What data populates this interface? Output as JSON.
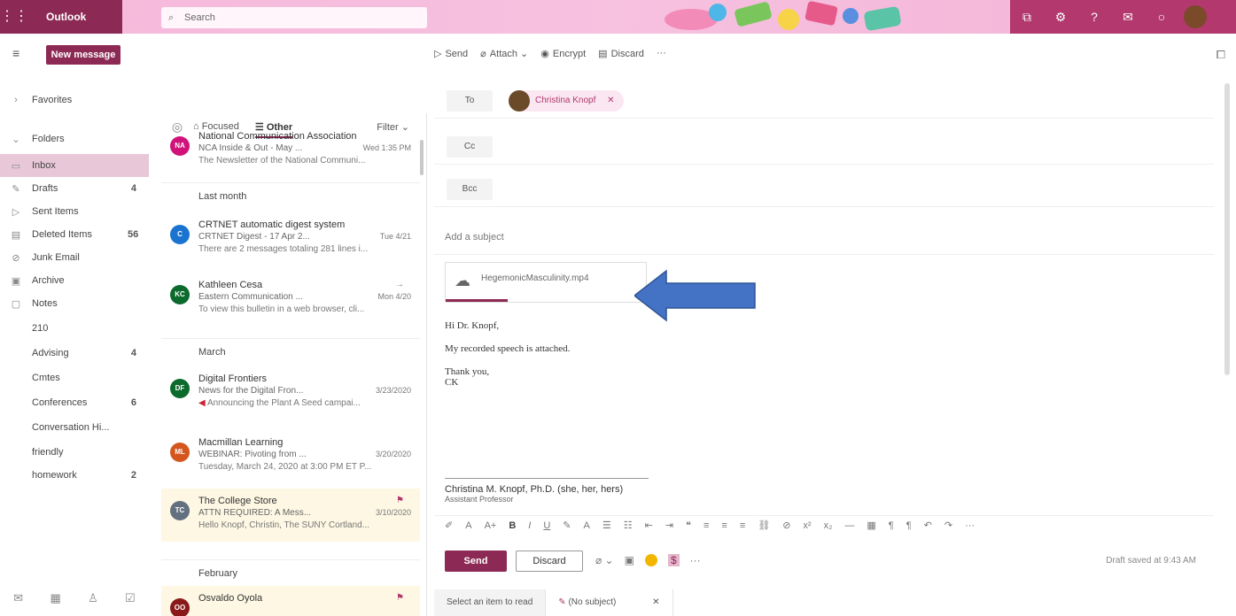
{
  "app": {
    "brand": "Outlook",
    "waffle_icon": "waffle-icon"
  },
  "search": {
    "placeholder": "Search"
  },
  "top_icons": [
    "meet-now-icon",
    "settings-icon",
    "help-icon",
    "feedback-icon",
    "skype-icon"
  ],
  "command": {
    "new_message": "New message"
  },
  "toolbar": {
    "send": "Send",
    "attach": "Attach",
    "encrypt": "Encrypt",
    "discard": "Discard",
    "more": "···"
  },
  "nav": {
    "items": [
      {
        "icon": "chevron-right-icon",
        "label": "Favorites",
        "count": ""
      },
      {
        "icon": "chevron-down-icon",
        "label": "Folders",
        "count": ""
      },
      {
        "icon": "inbox-icon",
        "label": "Inbox",
        "count": ""
      },
      {
        "icon": "pencil-icon",
        "label": "Drafts",
        "count": "4"
      },
      {
        "icon": "send-icon",
        "label": "Sent Items",
        "count": ""
      },
      {
        "icon": "trash-icon",
        "label": "Deleted Items",
        "count": "56"
      },
      {
        "icon": "block-icon",
        "label": "Junk Email",
        "count": ""
      },
      {
        "icon": "archive-icon",
        "label": "Archive",
        "count": ""
      },
      {
        "icon": "notes-icon",
        "label": "Notes",
        "count": ""
      },
      {
        "icon": "",
        "label": "210",
        "count": ""
      },
      {
        "icon": "",
        "label": "Advising",
        "count": "4"
      },
      {
        "icon": "",
        "label": "Cmtes",
        "count": ""
      },
      {
        "icon": "",
        "label": "Conferences",
        "count": "6"
      },
      {
        "icon": "",
        "label": "Conversation Hi...",
        "count": ""
      },
      {
        "icon": "",
        "label": "friendly",
        "count": ""
      },
      {
        "icon": "",
        "label": "homework",
        "count": "2"
      }
    ]
  },
  "list": {
    "tabs": {
      "focused": "Focused",
      "other": "Other",
      "filter": "Filter"
    },
    "groups": {
      "last_month": "Last month",
      "march": "March",
      "february": "February"
    },
    "messages": [
      {
        "initials": "NA",
        "from": "National Communication Association",
        "subject": "NCA Inside & Out - May ...",
        "date": "Wed 1:35 PM",
        "preview": "The Newsletter of the National Communi...",
        "color": "#d0127a"
      },
      {
        "initials": "C",
        "from": "CRTNET automatic digest system",
        "subject": "CRTNET Digest - 17 Apr 2...",
        "date": "Tue 4/21",
        "preview": "There are 2 messages totaling 281 lines i...",
        "color": "#1a73d1"
      },
      {
        "initials": "KC",
        "from": "Kathleen Cesa",
        "subject": "Eastern Communication ...",
        "date": "Mon 4/20",
        "preview": "To view this bulletin in a web browser, cli...",
        "color": "#0b6a2c"
      },
      {
        "initials": "DF",
        "from": "Digital Frontiers",
        "subject": "News for the Digital Fron...",
        "date": "3/23/2020",
        "preview": "Announcing the Plant A Seed campai...",
        "color": "#0b6a2c"
      },
      {
        "initials": "ML",
        "from": "Macmillan Learning",
        "subject": "WEBINAR: Pivoting from ...",
        "date": "3/20/2020",
        "preview": "Tuesday, March 24, 2020 at 3:00 PM ET P...",
        "color": "#d4561d"
      },
      {
        "initials": "TC",
        "from": "The College Store",
        "subject": "ATTN REQUIRED: A Mess...",
        "date": "3/10/2020",
        "preview": "Hello Knopf, Christin, The SUNY Cortland...",
        "color": "#637080"
      },
      {
        "initials": "OO",
        "from": "Osvaldo Oyola",
        "subject": "",
        "date": "",
        "preview": "",
        "color": "#8a1a1a"
      }
    ]
  },
  "compose": {
    "to_label": "To",
    "cc_label": "Cc",
    "bcc_label": "Bcc",
    "recipient": "Christina Knopf",
    "subject_placeholder": "Add a subject",
    "attachment": "HegemonicMasculinity.mp4",
    "body": {
      "greeting": "Hi Dr. Knopf,",
      "line1": "My recorded speech is attached.",
      "closing": "Thank you,",
      "initials": "CK"
    },
    "signature": {
      "name_line": "Christina M. Knopf, Ph.D. (she, her, hers)",
      "title_line": "Assistant Professor"
    },
    "send_label": "Send",
    "discard_label": "Discard",
    "saved_status": "Draft saved at 9:43 AM"
  },
  "bottom_tabs": {
    "reading": "Select an item to read",
    "draft": "(No subject)"
  },
  "colors": {
    "brand": "#8c2a55",
    "accent": "#b2386e",
    "arrow": "#4472c4"
  }
}
